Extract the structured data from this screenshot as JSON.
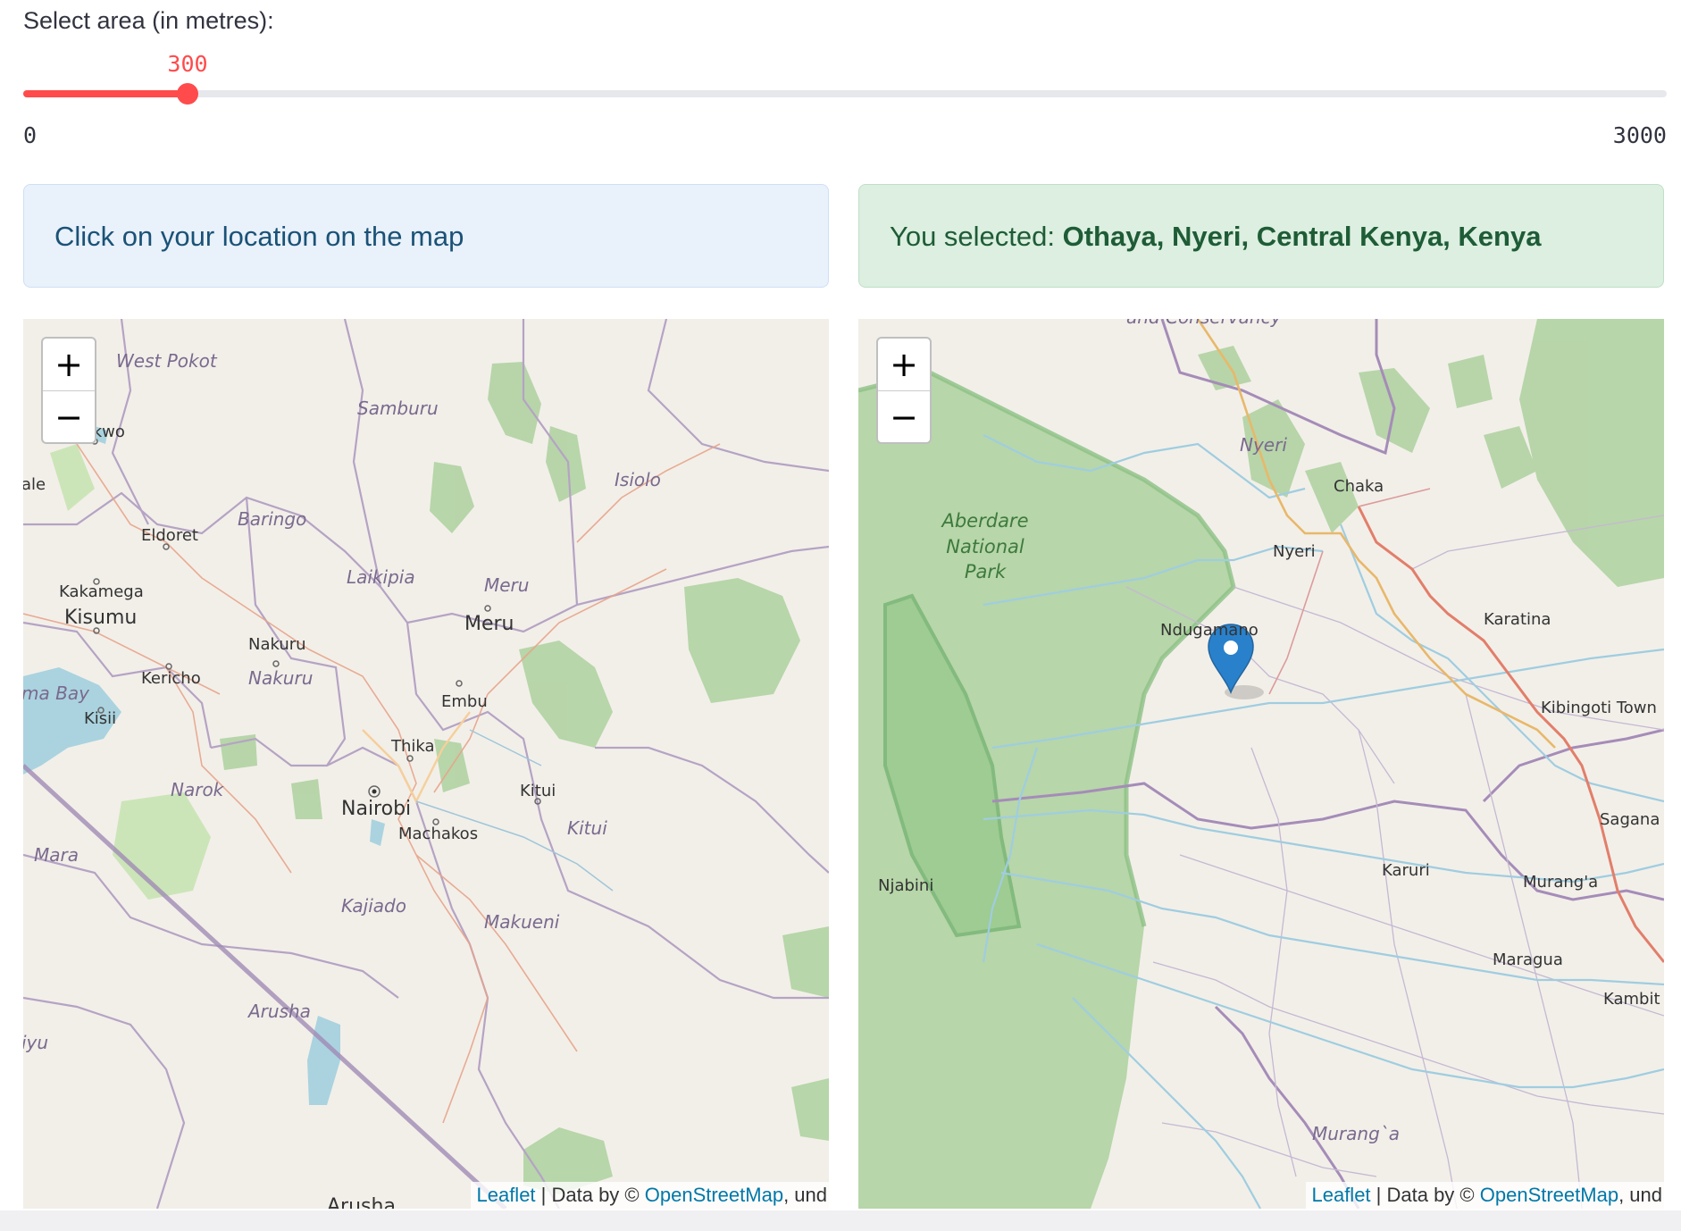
{
  "slider": {
    "label": "Select area (in metres):",
    "value": 300,
    "value_text": "300",
    "min": 0,
    "max": 3000,
    "min_text": "0",
    "max_text": "3000"
  },
  "info_alert": {
    "text": "Click on your location on the map"
  },
  "success_alert": {
    "prefix": "You selected: ",
    "location": "Othaya, Nyeri, Central Kenya, Kenya"
  },
  "zoom": {
    "in": "+",
    "out": "−"
  },
  "attribution": {
    "leaflet": "Leaflet",
    "sep": " | Data by © ",
    "osm": "OpenStreetMap",
    "tail": ", und"
  },
  "left_map": {
    "labels": {
      "west_pokot": "West Pokot",
      "samburu": "Samburu",
      "bukwo": "Bukwo",
      "isiolo": "Isiolo",
      "ale": "ale",
      "baringo": "Baringo",
      "eldoret": "Eldoret",
      "laikipia": "Laikipia",
      "meru_county": "Meru",
      "kakamega": "Kakamega",
      "kisumu": "Kisumu",
      "meru_town": "Meru",
      "nakuru_town": "Nakuru",
      "kericho": "Kericho",
      "nakuru_county": "Nakuru",
      "embu": "Embu",
      "ma_bay": "ma Bay",
      "kisii": "Kisii",
      "thika": "Thika",
      "narok": "Narok",
      "kitui_town": "Kitui",
      "nairobi": "Nairobi",
      "machakos": "Machakos",
      "kitui_county": "Kitui",
      "mara": "Mara",
      "kajiado": "Kajiado",
      "makueni": "Makueni",
      "arusha_region": "Arusha",
      "arusha_town": "Arusha",
      "iyu": "iyu"
    }
  },
  "right_map": {
    "labels": {
      "conservancy": "and Conservancy",
      "nyeri_county": "Nyeri",
      "chaka": "Chaka",
      "aberdare_1": "Aberdare",
      "aberdare_2": "National",
      "aberdare_3": "Park",
      "nyeri_town": "Nyeri",
      "karatina": "Karatina",
      "ndugamano": "Ndugamano",
      "kibingoti": "Kibingoti Town",
      "sagana": "Sagana",
      "karuri": "Karuri",
      "njabini": "Njabini",
      "muranga_town": "Murang'a",
      "maragua": "Maragua",
      "muranga_county": "Murang`a",
      "kambiti": "Kambit"
    }
  }
}
